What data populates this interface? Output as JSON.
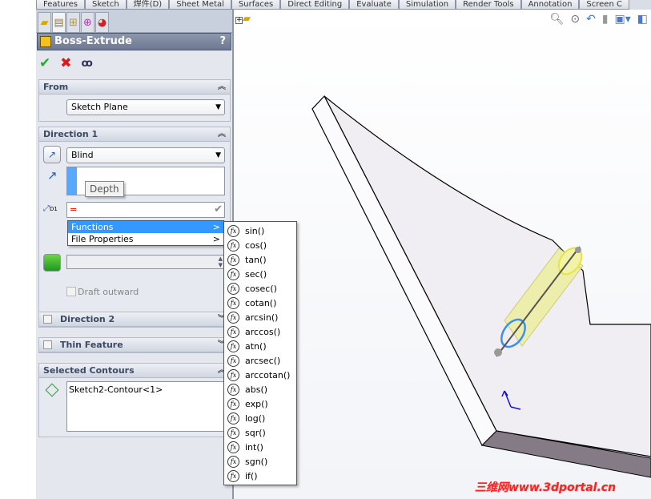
{
  "tabs": [
    "Features",
    "Sketch",
    "焊件(D)",
    "Sheet Metal",
    "Surfaces",
    "Direct Editing",
    "Evaluate",
    "Simulation",
    "Render Tools",
    "Annotation",
    "Screen C"
  ],
  "panel_tabs": [
    "feature-manager-icon",
    "property-manager-icon",
    "configuration-manager-icon",
    "dimxpert-icon",
    "display-manager-icon"
  ],
  "property_manager": {
    "title": "Boss-Extrude",
    "help": "?",
    "from": {
      "label": "From",
      "value": "Sketch Plane"
    },
    "direction1": {
      "label": "Direction 1",
      "end_condition": "Blind",
      "depth_tooltip": "Depth",
      "equation_value": "=",
      "dim_label": "D1",
      "draft_label": "Draft outward"
    },
    "direction2": {
      "label": "Direction 2"
    },
    "thin_feature": {
      "label": "Thin Feature"
    },
    "selected_contours": {
      "label": "Selected Contours",
      "items": [
        "Sketch2-Contour<1>"
      ]
    }
  },
  "context_menu": {
    "items": [
      {
        "label": "Functions",
        "submenu": ">"
      },
      {
        "label": "File Properties",
        "submenu": ">"
      }
    ]
  },
  "functions": [
    "sin()",
    "cos()",
    "tan()",
    "sec()",
    "cosec()",
    "cotan()",
    "arcsin()",
    "arccos()",
    "atn()",
    "arcsec()",
    "arccotan()",
    "abs()",
    "exp()",
    "log()",
    "sqr()",
    "int()",
    "sgn()",
    "if()"
  ],
  "watermark": "三维网www.3dportal.cn",
  "colors": {
    "accent": "#3399ff",
    "title_bar": "#7a859c"
  }
}
